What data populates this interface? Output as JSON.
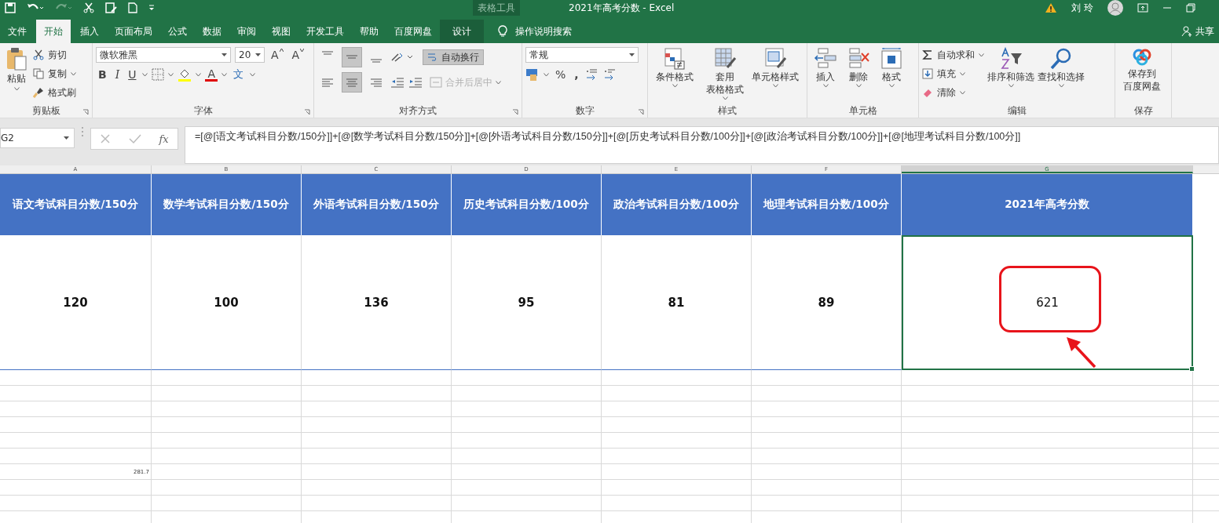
{
  "title_bar": {
    "quick_access": [
      {
        "kind": "save",
        "disabled": false
      },
      {
        "kind": "undo",
        "disabled": false
      },
      {
        "kind": "redo",
        "disabled": true
      },
      {
        "kind": "cut",
        "disabled": false
      },
      {
        "kind": "preview",
        "disabled": false
      },
      {
        "kind": "new",
        "disabled": false
      },
      {
        "kind": "customize",
        "disabled": false
      }
    ],
    "contextual_label": "表格工具",
    "title": "2021年高考分数  -  Excel",
    "user": "刘 玲"
  },
  "tabs": [
    {
      "label": "文件",
      "selected": false,
      "kind": "normal"
    },
    {
      "label": "开始",
      "selected": true,
      "kind": "normal"
    },
    {
      "label": "插入",
      "selected": false,
      "kind": "normal"
    },
    {
      "label": "页面布局",
      "selected": false,
      "kind": "normal"
    },
    {
      "label": "公式",
      "selected": false,
      "kind": "normal"
    },
    {
      "label": "数据",
      "selected": false,
      "kind": "normal"
    },
    {
      "label": "审阅",
      "selected": false,
      "kind": "normal"
    },
    {
      "label": "视图",
      "selected": false,
      "kind": "normal"
    },
    {
      "label": "开发工具",
      "selected": false,
      "kind": "normal"
    },
    {
      "label": "帮助",
      "selected": false,
      "kind": "normal"
    },
    {
      "label": "百度网盘",
      "selected": false,
      "kind": "normal"
    },
    {
      "label": "设计",
      "selected": false,
      "kind": "contextual"
    }
  ],
  "tell_me": "操作说明搜索",
  "share": "共享",
  "ribbon": {
    "clipboard": {
      "label": "剪贴板",
      "paste": "粘贴",
      "cut": "剪切",
      "copy": "复制",
      "format_painter": "格式刷"
    },
    "font": {
      "label": "字体",
      "font_name": "微软雅黑",
      "font_size": "20",
      "grow": "A",
      "shrink": "A",
      "bold": "B",
      "italic": "I",
      "underline": "U",
      "font_color": "A",
      "phonetic": "文"
    },
    "alignment": {
      "label": "对齐方式",
      "vertical_buttons": [
        {
          "selected": false
        },
        {
          "selected": true
        },
        {
          "selected": false
        }
      ],
      "horizontal_buttons": [
        {
          "selected": false
        },
        {
          "selected": true
        },
        {
          "selected": false
        }
      ],
      "wrap_text": {
        "label": "自动换行",
        "selected": true
      },
      "merge": {
        "label": "合并后居中",
        "disabled": true
      }
    },
    "number": {
      "label": "数字",
      "format": "常规",
      "percent": "%",
      "comma": ","
    },
    "styles": {
      "label": "样式",
      "buttons": [
        {
          "kind": "conditional",
          "lines": [
            "条件格式"
          ]
        },
        {
          "kind": "table",
          "lines": [
            "套用",
            "表格格式"
          ]
        },
        {
          "kind": "cell",
          "lines": [
            "单元格样式"
          ]
        }
      ]
    },
    "cells": {
      "label": "单元格",
      "buttons": [
        {
          "kind": "insert",
          "label": "插入"
        },
        {
          "kind": "delete",
          "label": "删除"
        },
        {
          "kind": "format",
          "label": "格式"
        }
      ]
    },
    "editing": {
      "label": "编辑",
      "small": [
        {
          "kind": "sum",
          "label": "自动求和"
        },
        {
          "kind": "fill",
          "label": "填充"
        },
        {
          "kind": "clear",
          "label": "清除"
        }
      ],
      "large": [
        {
          "kind": "sort",
          "label": "排序和筛选"
        },
        {
          "kind": "find",
          "label": "查找和选择"
        }
      ]
    },
    "save": {
      "label": "保存",
      "lines": [
        "保存到",
        "百度网盘"
      ]
    }
  },
  "formula_bar": {
    "name_box": "G2",
    "function_label": "fx",
    "formula": "=[@[语文考试科目分数/150分]]+[@[数学考试科目分数/150分]]+[@[外语考试科目分数/150分]]+[@[历史考试科目分数/100分]]+[@[政治考试科目分数/100分]]+[@[地理考试科目分数/100分]]"
  },
  "sheet": {
    "columns": [
      {
        "label": "A",
        "selected": false
      },
      {
        "label": "B",
        "selected": false
      },
      {
        "label": "C",
        "selected": false
      },
      {
        "label": "D",
        "selected": false
      },
      {
        "label": "E",
        "selected": false
      },
      {
        "label": "F",
        "selected": false
      },
      {
        "label": "G",
        "selected": true
      }
    ],
    "header_row": [
      "语文考试科目分数/150分",
      "数学考试科目分数/150分",
      "外语考试科目分数/150分",
      "历史考试科目分数/100分",
      "政治考试科目分数/100分",
      "地理考试科目分数/100分",
      "2021年高考分数"
    ],
    "data_row": [
      {
        "text": "120",
        "selected": false
      },
      {
        "text": "100",
        "selected": false
      },
      {
        "text": "136",
        "selected": false
      },
      {
        "text": "95",
        "selected": false
      },
      {
        "text": "81",
        "selected": false
      },
      {
        "text": "89",
        "selected": false
      },
      {
        "text": "621",
        "selected": true,
        "highlighted": true
      }
    ],
    "note_cell": "281.7"
  }
}
